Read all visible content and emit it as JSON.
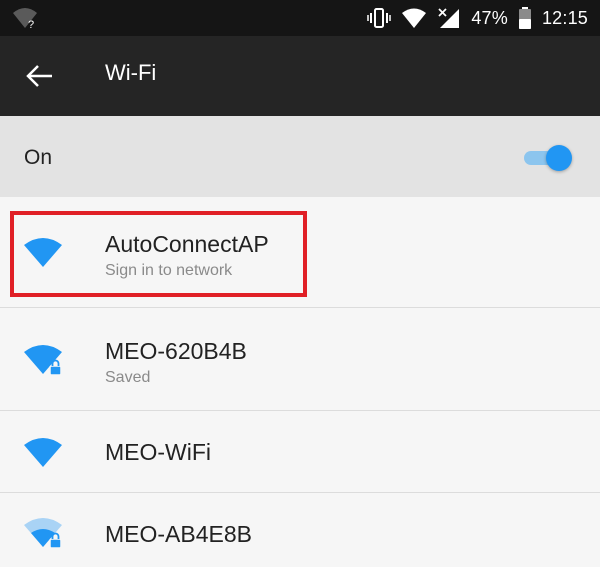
{
  "status_bar": {
    "battery": "47%",
    "time": "12:15",
    "icons": [
      "wifi-question-icon",
      "vibrate-icon",
      "wifi-full-icon",
      "no-signal-icon",
      "battery-icon"
    ]
  },
  "toolbar": {
    "back_icon": "arrow-back-icon",
    "title": "Wi-Fi"
  },
  "wifi_toggle": {
    "label": "On",
    "state": true,
    "accent_color": "#2196f3"
  },
  "networks": [
    {
      "name": "AutoConnectAP",
      "status": "Sign in to network",
      "signal": "full",
      "secured": false,
      "highlighted": true
    },
    {
      "name": "MEO-620B4B",
      "status": "Saved",
      "signal": "full",
      "secured": true,
      "highlighted": false
    },
    {
      "name": "MEO-WiFi",
      "status": "",
      "signal": "full",
      "secured": false,
      "highlighted": false
    },
    {
      "name": "MEO-AB4E8B",
      "status": "",
      "signal": "medium",
      "secured": true,
      "highlighted": false
    }
  ],
  "colors": {
    "wifi_icon": "#2196f3",
    "highlight": "#e01f26"
  }
}
